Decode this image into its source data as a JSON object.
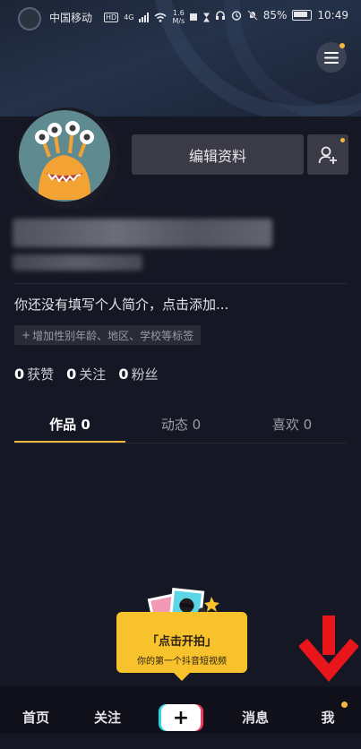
{
  "status_bar": {
    "carrier": "中国移动",
    "hd": "HD",
    "net": "4G",
    "speed_value": "1.6",
    "speed_unit": "M/s",
    "battery": "85%",
    "time": "10:49"
  },
  "profile": {
    "edit_button": "编辑资料",
    "bio": "你还没有填写个人简介，点击添加...",
    "tag_prefix": "+",
    "tag_hint": "增加性别年龄、地区、学校等标签"
  },
  "stats": [
    {
      "count": "0",
      "label": "获赞"
    },
    {
      "count": "0",
      "label": "关注"
    },
    {
      "count": "0",
      "label": "粉丝"
    }
  ],
  "tabs": [
    {
      "label": "作品 0",
      "active": true
    },
    {
      "label": "动态 0",
      "active": false
    },
    {
      "label": "喜欢 0",
      "active": false
    }
  ],
  "bubble": {
    "title": "「点击开拍」",
    "subtitle": "你的第一个抖音短视频"
  },
  "bottom_nav": {
    "home": "首页",
    "follow": "关注",
    "create": "+",
    "messages": "消息",
    "me": "我"
  },
  "colors": {
    "accent": "#f5b83d",
    "background": "#161724",
    "arrow": "#e8161b"
  }
}
